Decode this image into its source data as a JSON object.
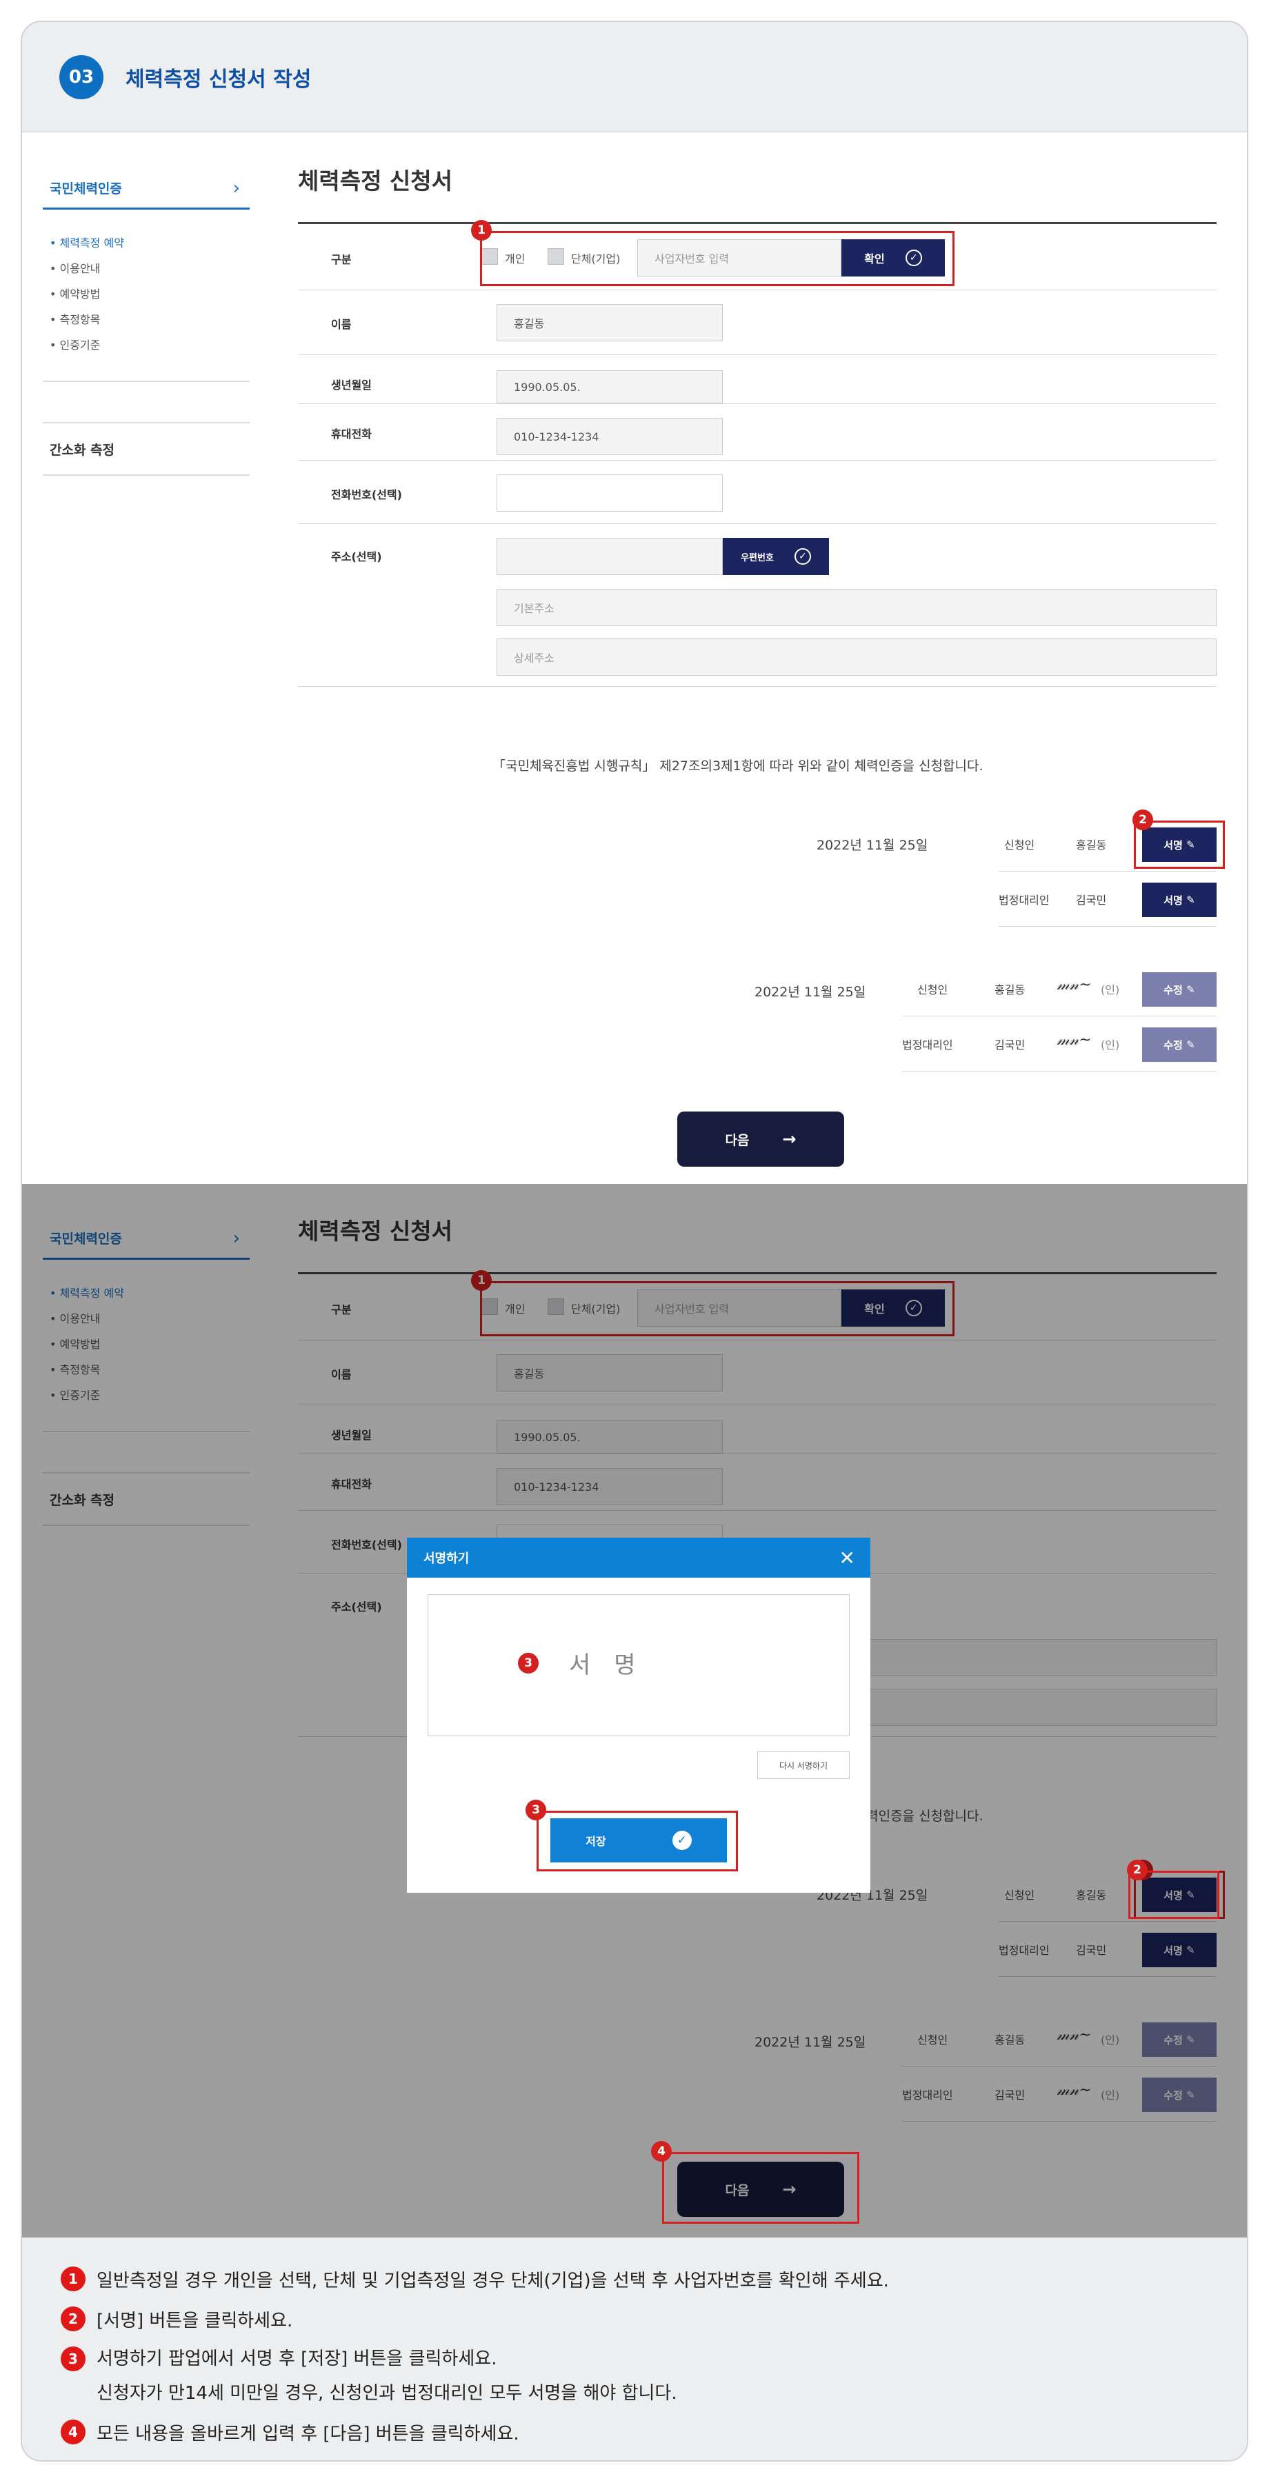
{
  "header": {
    "step": "03",
    "title": "체력측정 신청서 작성"
  },
  "sidebar": {
    "top_label": "국민체력인증",
    "chevron": "chevron-right-icon",
    "items": [
      "• 체력측정 예약",
      "• 이용안내",
      "• 예약방법",
      "• 측정항목",
      "• 인증기준"
    ],
    "second_label": "간소화 측정"
  },
  "form": {
    "title": "체력측정 신청서",
    "type_label": "구분",
    "type_individual": "개인",
    "type_group": "단체(기업)",
    "business_placeholder": "사업자번호 입력",
    "confirm_label": "확인",
    "name_label": "이름",
    "name_value": "홍길동",
    "birth_label": "생년월일",
    "birth_value": "1990.05.05.",
    "mobile_label": "휴대전화",
    "mobile_value": "010-1234-1234",
    "phone_label": "전화번호(선택)",
    "phone_value": "",
    "address_label": "주소(선택)",
    "zipcode_label": "우편번호",
    "address_basic_placeholder": "기본주소",
    "address_detail_placeholder": "상세주소",
    "statement": "「국민체육진흥법 시행규칙」 제27조의3제1항에 따라 위와 같이 체력인증을 신청합니다.",
    "date": "2022년 11월 25일",
    "applicant_label": "신청인",
    "applicant_name": "홍길동",
    "guardian_label": "법정대리인",
    "guardian_name": "김국민",
    "sign_label": "서명",
    "edit_label": "수정",
    "seal_label": "(인)",
    "next_label": "다음",
    "arrow": "→"
  },
  "modal": {
    "title": "서명하기",
    "sign_placeholder": "서　명",
    "redo_label": "다시 서명하기",
    "save_label": "저장"
  },
  "notes": [
    {
      "num": "1",
      "text": "일반측정일 경우 개인을 선택, 단체 및 기업측정일 경우 단체(기업)을 선택 후 사업자번호를 확인해 주세요."
    },
    {
      "num": "2",
      "text": "[서명] 버튼을 클릭하세요."
    },
    {
      "num": "3",
      "text": "서명하기 팝업에서 서명 후 [저장] 버튼을 클릭하세요.",
      "text2": "신청자가 만14세 미만일 경우, 신청인과 법정대리인 모두 서명을 해야 합니다."
    },
    {
      "num": "4",
      "text": "모든 내용을 올바르게 입력 후 [다음] 버튼을 클릭하세요."
    }
  ],
  "colors": {
    "accent": "#0d6fc2",
    "navy": "#1c2560",
    "callout": "#d52020",
    "modal_header": "#0d82d5"
  }
}
